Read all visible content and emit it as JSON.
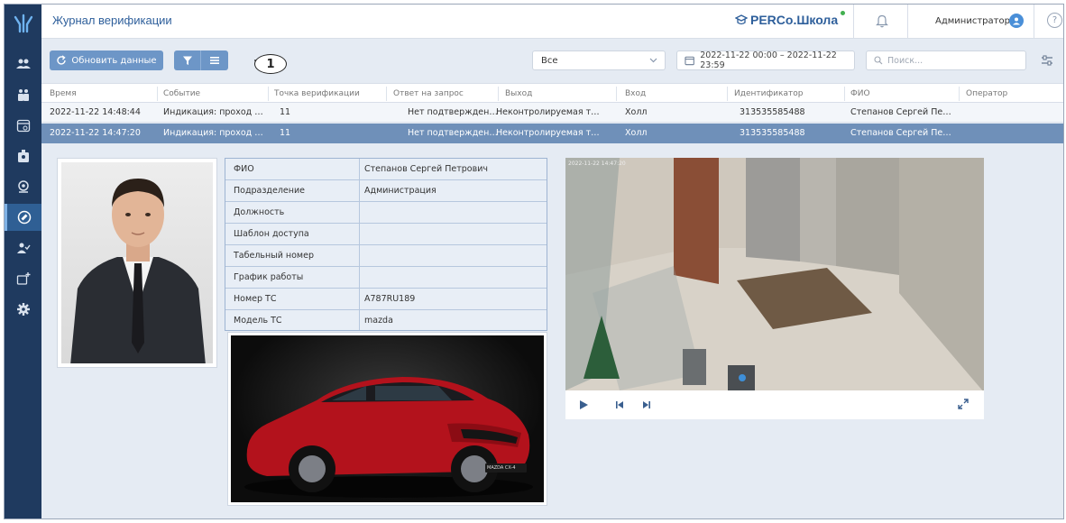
{
  "app": {
    "page_title": "Журнал верификации",
    "brand": "PERCo.Школа",
    "user_name": "Администратор",
    "help_label": "?"
  },
  "toolbar": {
    "refresh_label": "Обновить данные",
    "callout_number": "1",
    "event_filter_value": "Все",
    "date_range_value": "2022-11-22 00:00 – 2022-11-22 23:59",
    "search_placeholder": "Поиск..."
  },
  "table": {
    "columns": [
      "Время",
      "Событие",
      "Точка верификации",
      "Ответ на запрос",
      "Выход",
      "Вход",
      "Идентификатор",
      "ФИО",
      "Оператор"
    ],
    "rows": [
      [
        "2022-11-22 14:48:44",
        "Индикация: проход со...",
        "11",
        "Нет подтверждения",
        "Неконтролируемая те...",
        "Холл",
        "313535585488",
        "Степанов Сергей Петр...",
        ""
      ],
      [
        "2022-11-22 14:47:20",
        "Индикация: проход со...",
        "11",
        "Нет подтверждения",
        "Неконтролируемая те...",
        "Холл",
        "313535585488",
        "Степанов Сергей Петр...",
        ""
      ]
    ]
  },
  "details": {
    "fields": [
      {
        "label": "ФИО",
        "value": "Степанов Сергей Петрович"
      },
      {
        "label": "Подразделение",
        "value": "Администрация"
      },
      {
        "label": "Должность",
        "value": ""
      },
      {
        "label": "Шаблон доступа",
        "value": ""
      },
      {
        "label": "Табельный номер",
        "value": ""
      },
      {
        "label": "График работы",
        "value": ""
      },
      {
        "label": "Номер ТС",
        "value": "А787RU189"
      },
      {
        "label": "Модель ТС",
        "value": "mazda"
      }
    ],
    "car_plate_text": "MAZDA CX-4"
  },
  "video": {
    "timestamp": "2022-11-22 14:47:20"
  },
  "colors": {
    "sidebar": "#1f3a5f",
    "accent": "#2e5f9b",
    "button": "#6d96c7",
    "selected_row": "#6f90b9",
    "background": "#e5ebf3"
  },
  "icons": [
    "logo-icon",
    "users-icon",
    "employees-icon",
    "schedule-icon",
    "badge-icon",
    "location-icon",
    "verification-icon",
    "user-check-icon",
    "add-device-icon",
    "gear-icon",
    "refresh-icon",
    "filter-icon",
    "menu-icon",
    "calendar-icon",
    "search-icon",
    "bell-icon",
    "user-avatar-icon",
    "sliders-icon",
    "play-icon",
    "skip-back-icon",
    "skip-forward-icon",
    "fullscreen-icon"
  ]
}
